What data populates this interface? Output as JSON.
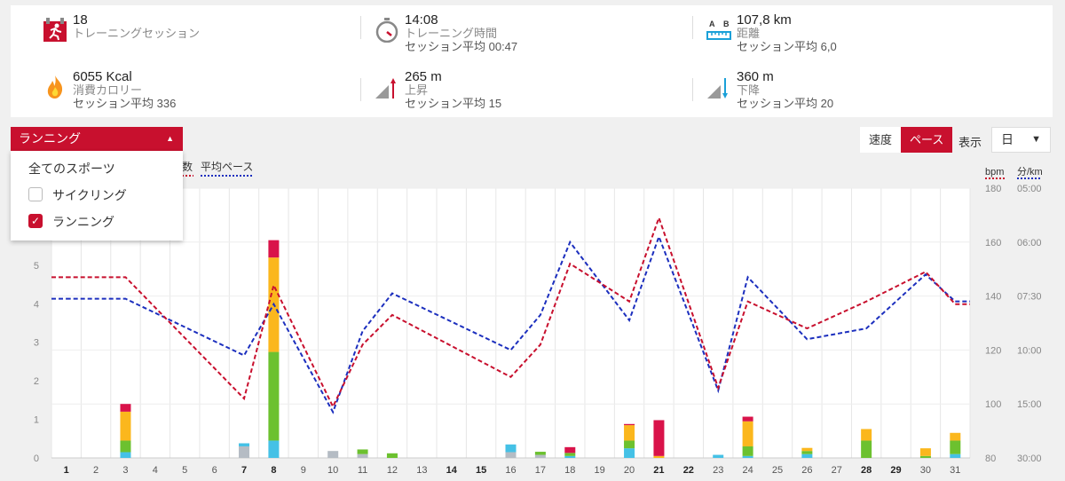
{
  "stats": [
    {
      "value": "18",
      "label": "トレーニングセッション",
      "sub": "",
      "icon": "runner-calendar-icon"
    },
    {
      "value": "14:08",
      "label": "トレーニング時間",
      "sub": "セッション平均 00:47",
      "icon": "stopwatch-icon"
    },
    {
      "value": "107,8 km",
      "label": "距離",
      "sub": "セッション平均 6,0",
      "icon": "ruler-distance-icon"
    },
    {
      "value": "6055 Kcal",
      "label": "消費カロリー",
      "sub": "セッション平均 336",
      "icon": "flame-icon"
    },
    {
      "value": "265 m",
      "label": "上昇",
      "sub": "セッション平均 15",
      "icon": "ascent-icon"
    },
    {
      "value": "360 m",
      "label": "下降",
      "sub": "セッション平均 20",
      "icon": "descent-icon"
    }
  ],
  "ruler_ab": {
    "a": "A",
    "b": "B"
  },
  "sport_dropdown": {
    "selected": "ランニング",
    "caret": "▲",
    "options": [
      {
        "label": "全てのスポーツ",
        "checkbox": false,
        "checked": false
      },
      {
        "label": "サイクリング",
        "checkbox": true,
        "checked": false
      },
      {
        "label": "ランニング",
        "checkbox": true,
        "checked": true
      }
    ]
  },
  "mode_buttons": {
    "speed": "速度",
    "pace": "ペース",
    "active": "pace"
  },
  "display": {
    "label": "表示",
    "selected": "日",
    "caret": "▼"
  },
  "colors": {
    "accent": "#c8102e",
    "hr_line": "#c8102e",
    "pace_line": "#1c2fbe",
    "zone_gray": "#b5bcc4",
    "zone_blue": "#45c1e6",
    "zone_green": "#6cc12f",
    "zone_yellow": "#fbb71d",
    "zone_red": "#d9134a"
  },
  "chart_data": {
    "type": "bar",
    "legend": [
      {
        "name": "数",
        "color": "#c8102e",
        "style": "dotted"
      },
      {
        "name": "平均ペース",
        "color": "#1c2fbe",
        "style": "dotted"
      }
    ],
    "left_axis": {
      "ticks": [
        0,
        1,
        2,
        3,
        4,
        5
      ],
      "ylim": [
        0,
        7
      ]
    },
    "right_axes": [
      {
        "title": "bpm",
        "ticks": [
          "80",
          "100",
          "120",
          "140",
          "160",
          "180"
        ],
        "ylim": [
          80,
          180
        ]
      },
      {
        "title": "分/km",
        "ticks": [
          "30:00",
          "15:00",
          "10:00",
          "07:30",
          "06:00",
          "05:00"
        ]
      }
    ],
    "x": [
      1,
      2,
      3,
      4,
      5,
      6,
      7,
      8,
      9,
      10,
      11,
      12,
      13,
      14,
      15,
      16,
      17,
      18,
      19,
      20,
      21,
      22,
      23,
      24,
      25,
      26,
      27,
      28,
      29,
      30,
      31
    ],
    "bold_days": [
      1,
      7,
      8,
      14,
      15,
      21,
      22,
      28,
      29
    ],
    "bars": [
      {
        "day": 3,
        "zones": {
          "blue": 0.15,
          "green": 0.3,
          "yellow": 0.75,
          "red": 0.2
        }
      },
      {
        "day": 7,
        "zones": {
          "gray": 0.3,
          "blue": 0.08
        }
      },
      {
        "day": 8,
        "zones": {
          "blue": 0.45,
          "green": 2.3,
          "yellow": 2.45,
          "red": 0.45
        }
      },
      {
        "day": 10,
        "zones": {
          "gray": 0.18
        }
      },
      {
        "day": 11,
        "zones": {
          "gray": 0.1,
          "green": 0.12
        }
      },
      {
        "day": 12,
        "zones": {
          "green": 0.12
        }
      },
      {
        "day": 16,
        "zones": {
          "gray": 0.15,
          "blue": 0.2
        }
      },
      {
        "day": 17,
        "zones": {
          "gray": 0.08,
          "green": 0.08
        }
      },
      {
        "day": 18,
        "zones": {
          "blue": 0.05,
          "green": 0.08,
          "red": 0.15
        }
      },
      {
        "day": 20,
        "zones": {
          "blue": 0.25,
          "green": 0.2,
          "yellow": 0.4,
          "red": 0.03
        }
      },
      {
        "day": 21,
        "zones": {
          "yellow": 0.05,
          "red": 0.93
        }
      },
      {
        "day": 23,
        "zones": {
          "blue": 0.08
        }
      },
      {
        "day": 24,
        "zones": {
          "blue": 0.05,
          "green": 0.25,
          "yellow": 0.65,
          "red": 0.12
        }
      },
      {
        "day": 26,
        "zones": {
          "blue": 0.1,
          "green": 0.08,
          "yellow": 0.08
        }
      },
      {
        "day": 28,
        "zones": {
          "green": 0.45,
          "yellow": 0.3
        }
      },
      {
        "day": 30,
        "zones": {
          "green": 0.05,
          "yellow": 0.2
        }
      },
      {
        "day": 31,
        "zones": {
          "blue": 0.1,
          "green": 0.35,
          "yellow": 0.2
        }
      }
    ],
    "hr_series": {
      "name": "数",
      "days": [
        1,
        3,
        7,
        8,
        10,
        11,
        12,
        16,
        17,
        18,
        20,
        21,
        23,
        24,
        26,
        28,
        30,
        31
      ],
      "values": [
        147,
        147,
        102,
        144,
        99,
        122,
        133,
        110,
        122,
        152,
        138,
        169,
        106,
        138,
        128,
        138,
        149,
        137
      ]
    },
    "pace_series": {
      "name": "平均ペース",
      "days": [
        1,
        3,
        7,
        8,
        10,
        11,
        12,
        16,
        17,
        18,
        20,
        21,
        23,
        24,
        26,
        28,
        30,
        31
      ],
      "values": [
        139,
        139,
        118,
        137,
        97,
        127,
        141,
        120,
        133,
        160,
        131,
        162,
        105,
        147,
        124,
        128,
        148,
        138
      ]
    }
  }
}
